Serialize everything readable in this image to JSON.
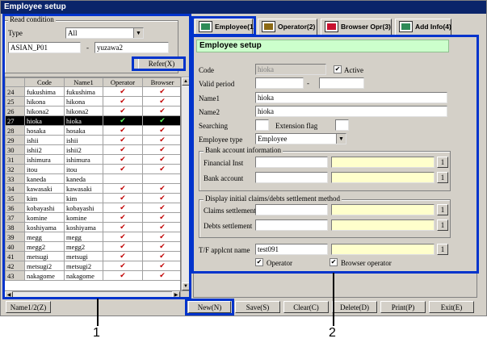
{
  "window": {
    "title": "Employee setup"
  },
  "read_condition": {
    "legend": "Read condition",
    "type_label": "Type",
    "type_value": "All",
    "from_value": "ASIAN_P01",
    "separator": "-",
    "to_value": "yuzawa2",
    "refer_label": "Refer(X)"
  },
  "employee_table": {
    "columns": [
      "",
      "Code",
      "Name1",
      "Operator",
      "Browser"
    ],
    "rows": [
      {
        "num": "24",
        "code": "fukushima",
        "name1": "fukushima",
        "operator": "✔",
        "browser": "✔"
      },
      {
        "num": "25",
        "code": "hikona",
        "name1": "hikona",
        "operator": "✔",
        "browser": "✔"
      },
      {
        "num": "26",
        "code": "hikona2",
        "name1": "hikona2",
        "operator": "✔",
        "browser": "✔"
      },
      {
        "num": "27",
        "code": "hioka",
        "name1": "hioka",
        "operator": "✔",
        "browser": "✔"
      },
      {
        "num": "28",
        "code": "hosaka",
        "name1": "hosaka",
        "operator": "✔",
        "browser": "✔"
      },
      {
        "num": "29",
        "code": "ishii",
        "name1": "ishii",
        "operator": "✔",
        "browser": "✔"
      },
      {
        "num": "30",
        "code": "ishii2",
        "name1": "ishii2",
        "operator": "✔",
        "browser": "✔"
      },
      {
        "num": "31",
        "code": "ishimura",
        "name1": "ishimura",
        "operator": "✔",
        "browser": "✔"
      },
      {
        "num": "32",
        "code": "itou",
        "name1": "itou",
        "operator": "✔",
        "browser": "✔"
      },
      {
        "num": "33",
        "code": "kaneda",
        "name1": "kaneda",
        "operator": "",
        "browser": ""
      },
      {
        "num": "34",
        "code": "kawasaki",
        "name1": "kawasaki",
        "operator": "✔",
        "browser": "✔"
      },
      {
        "num": "35",
        "code": "kim",
        "name1": "kim",
        "operator": "✔",
        "browser": "✔"
      },
      {
        "num": "36",
        "code": "kobayashi",
        "name1": "kobayashi",
        "operator": "✔",
        "browser": "✔"
      },
      {
        "num": "37",
        "code": "komine",
        "name1": "komine",
        "operator": "✔",
        "browser": "✔"
      },
      {
        "num": "38",
        "code": "koshiyama",
        "name1": "koshiyama",
        "operator": "✔",
        "browser": "✔"
      },
      {
        "num": "39",
        "code": "megg",
        "name1": "megg",
        "operator": "✔",
        "browser": "✔"
      },
      {
        "num": "40",
        "code": "megg2",
        "name1": "megg2",
        "operator": "✔",
        "browser": "✔"
      },
      {
        "num": "41",
        "code": "metsugi",
        "name1": "metsugi",
        "operator": "✔",
        "browser": "✔"
      },
      {
        "num": "42",
        "code": "metsugi2",
        "name1": "metsugi2",
        "operator": "✔",
        "browser": "✔"
      },
      {
        "num": "43",
        "code": "nakagome",
        "name1": "nakagome",
        "operator": "✔",
        "browser": "✔"
      }
    ],
    "selected_index": 3
  },
  "tabs": [
    {
      "label": "Employee(1)",
      "icon": "book-icon"
    },
    {
      "label": "Operator(2)",
      "icon": "document-icon"
    },
    {
      "label": "Browser Opr(3)",
      "icon": "window-icon"
    },
    {
      "label": "Add Info(4)",
      "icon": "book-icon"
    }
  ],
  "employee_setup": {
    "section_title": "Employee setup",
    "code_label": "Code",
    "code_value": "hioka",
    "active_label": "Active",
    "valid_period_label": "Valid period",
    "valid_from": "",
    "valid_sep": "-",
    "valid_to": "",
    "name1_label": "Name1",
    "name1_value": "hioka",
    "name2_label": "Name2",
    "name2_value": "hioka",
    "searching_label": "Searching",
    "extension_flag_label": "Extension flag",
    "employee_type_label": "Employee type",
    "employee_type_value": "Employee",
    "bank_legend": "Bank account information",
    "financial_inst_label": "Financial Inst",
    "bank_account_label": "Bank account",
    "claims_legend": "Display initial claims/debts settlement method",
    "claims_settlement_label": "Claims settlement",
    "debts_settlement_label": "Debts settlement",
    "tf_label": "T/F applcnt name",
    "tf_value": "test091",
    "operator_label": "Operator",
    "browser_operator_label": "Browser operator",
    "lookup_label": "1"
  },
  "bottom_buttons": {
    "name12": "Name1/2(Z)",
    "new": "New(N)",
    "save": "Save(S)",
    "clear": "Clear(C)",
    "delete": "Delete(D)",
    "print": "Print(P)",
    "exit": "Exit(E)"
  },
  "callouts": {
    "one": "1",
    "two": "2"
  },
  "colors": {
    "highlight": "#0033cc",
    "title": "#0a246a",
    "section": "#ccffcc",
    "yellow_field": "#ffffcc"
  }
}
